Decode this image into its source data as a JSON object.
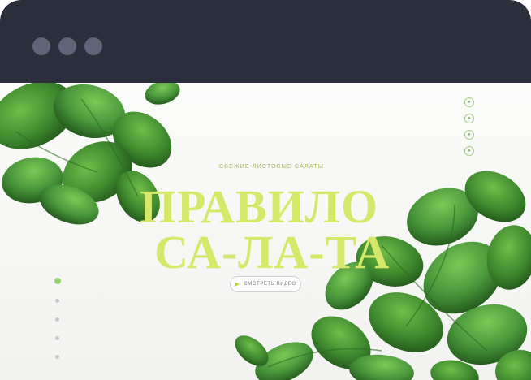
{
  "window": {
    "controls": [
      "dot-1",
      "dot-2",
      "dot-3"
    ]
  },
  "hero": {
    "eyebrow": "СВЕЖИЕ ЛИСТОВЫЕ САЛАТЫ",
    "title_line_1": "ПРАВИЛО",
    "title_line_2": "СА-ЛА-ТА",
    "cta_label": "СМОТРЕТЬ ВИДЕО",
    "cta_icon": "play-icon"
  },
  "slider": {
    "count": 5,
    "active": 1
  },
  "social": {
    "icons": [
      "social-icon-1",
      "social-icon-2",
      "social-icon-3",
      "social-icon-4"
    ]
  },
  "colors": {
    "titlebar": "#2b2e3b",
    "accent": "#d6e86a",
    "leaf": "#3f8a2e",
    "dot": "#616378"
  }
}
